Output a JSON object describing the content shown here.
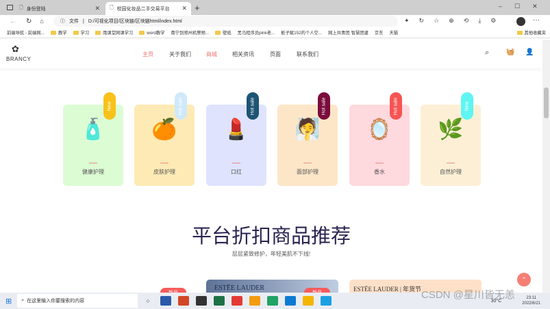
{
  "browser": {
    "tabs": [
      {
        "label": "身份登陆",
        "active": false
      },
      {
        "label": "校园化妆品二手交易平台",
        "active": true
      }
    ],
    "new_tab": "+",
    "url_prefix": "文件",
    "url": "D:/可视化项目/区块链/区块链html/index.html",
    "bookmarks": [
      "前端导航 - 前端网...",
      "教学",
      "学习",
      "雨课堂网课学习",
      "word教学",
      "南宁到郑州机票预...",
      "壁纸",
      "黑马程序员pink老...",
      "栀子赋152的个人空...",
      "网上共青团·智慧团建",
      "京东",
      "天猫"
    ],
    "other_bookmarks": "其他收藏夹"
  },
  "site": {
    "logo": "BRANCY",
    "nav": [
      {
        "label": "主页",
        "active": true
      },
      {
        "label": "关于我们"
      },
      {
        "label": "商城",
        "active": true
      },
      {
        "label": "相关资讯"
      },
      {
        "label": "页面"
      },
      {
        "label": "联系我们"
      }
    ],
    "categories": [
      {
        "label": "健康护理",
        "badge": "New",
        "badge_color": "#f8c21a",
        "bg": "#dcfcd4",
        "icon": "🧴"
      },
      {
        "label": "皮肤护理",
        "badge": "Hot sale",
        "badge_color": "#cfe9fb",
        "bg": "#feeab5",
        "icon": "🍊"
      },
      {
        "label": "口红",
        "badge": "Hot sale",
        "badge_color": "#1d5474",
        "bg": "#dfe3fd",
        "icon": "💄"
      },
      {
        "label": "面部护理",
        "badge": "Hot sale",
        "badge_color": "#7a0c3c",
        "bg": "#fde6c8",
        "icon": "🧖"
      },
      {
        "label": "香水",
        "badge": "Hot sale",
        "badge_color": "#f65453",
        "bg": "#fed9de",
        "icon": "🪞"
      },
      {
        "label": "自然护理",
        "badge": "New",
        "badge_color": "#5ef5f2",
        "bg": "#fdefd5",
        "icon": "🌿"
      }
    ],
    "section_title": "平台折扣商品推荐",
    "section_subtitle": "层层紧致修护，年轻美肌不下线!",
    "products": [
      {
        "brand": "ESTĒE LAUDER",
        "badge": "新品"
      },
      {
        "brand": "ESTĒE LAUDER | 年货节",
        "badge": "新品"
      }
    ],
    "back_to_top": "^"
  },
  "taskbar": {
    "search_placeholder": "在这里输入你要搜索的内容",
    "temp": "30°C",
    "time": "23:11",
    "date": "2022/6/21",
    "watermark": "CSDN @星川皆无恙"
  }
}
